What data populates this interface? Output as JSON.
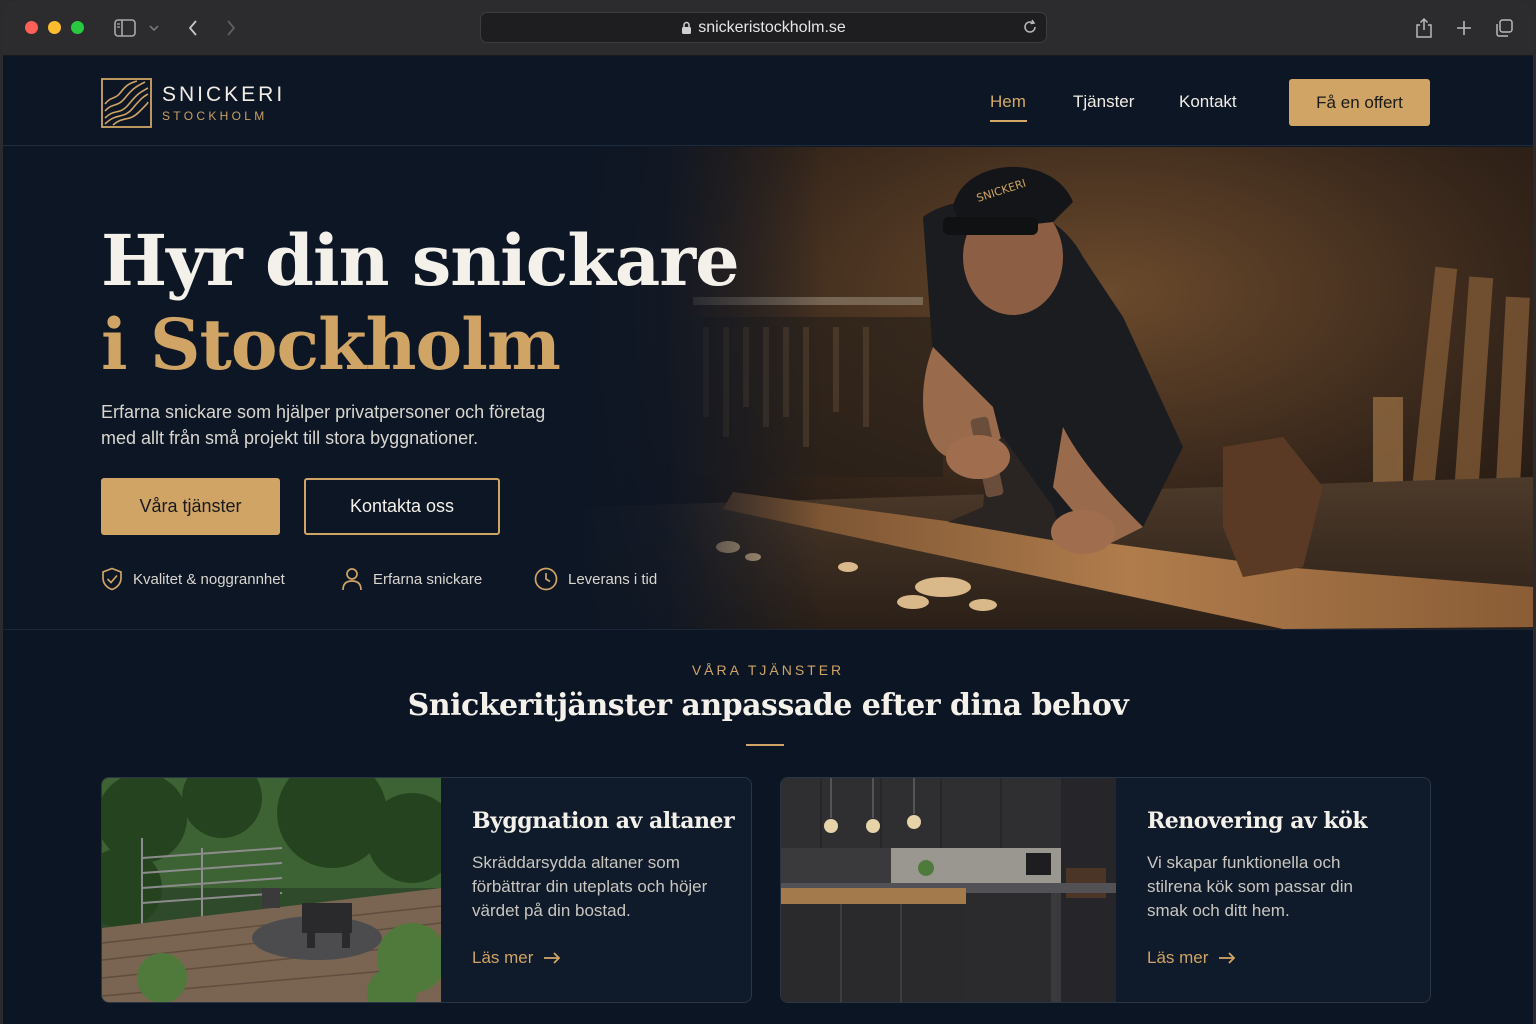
{
  "browser": {
    "url": "snickeristockholm.se"
  },
  "brand": {
    "name_line1": "SNICKERI",
    "name_line2": "STOCKHOLM",
    "accent": "#cfa465",
    "background": "#0d1625"
  },
  "nav": {
    "items": [
      {
        "label": "Hem",
        "active": true
      },
      {
        "label": "Tjänster",
        "active": false
      },
      {
        "label": "Kontakt",
        "active": false
      }
    ],
    "cta": "Få en offert"
  },
  "hero": {
    "title_line1": "Hyr din snickare",
    "title_line2": "i Stockholm",
    "subtitle": "Erfarna snickare som hjälper privatpersoner och företag med allt från små projekt till stora byggnationer.",
    "primary_button": "Våra tjänster",
    "secondary_button": "Kontakta oss",
    "features": [
      {
        "icon": "shield-check-icon",
        "label": "Kvalitet & noggrannhet"
      },
      {
        "icon": "person-icon",
        "label": "Erfarna snickare"
      },
      {
        "icon": "clock-icon",
        "label": "Leverans i tid"
      }
    ]
  },
  "services": {
    "eyebrow": "VÅRA TJÄNSTER",
    "title": "Snickeritjänster anpassade efter dina behov",
    "cards": [
      {
        "title": "Byggnation av altaner",
        "text": "Skräddarsydda altaner som förbättrar din uteplats och höjer värdet på din bostad.",
        "link": "Läs mer",
        "image": "deck-photo"
      },
      {
        "title": "Renovering av kök",
        "text": "Vi skapar funktionella och stilrena kök som passar din smak och ditt hem.",
        "link": "Läs mer",
        "image": "kitchen-photo"
      }
    ]
  }
}
